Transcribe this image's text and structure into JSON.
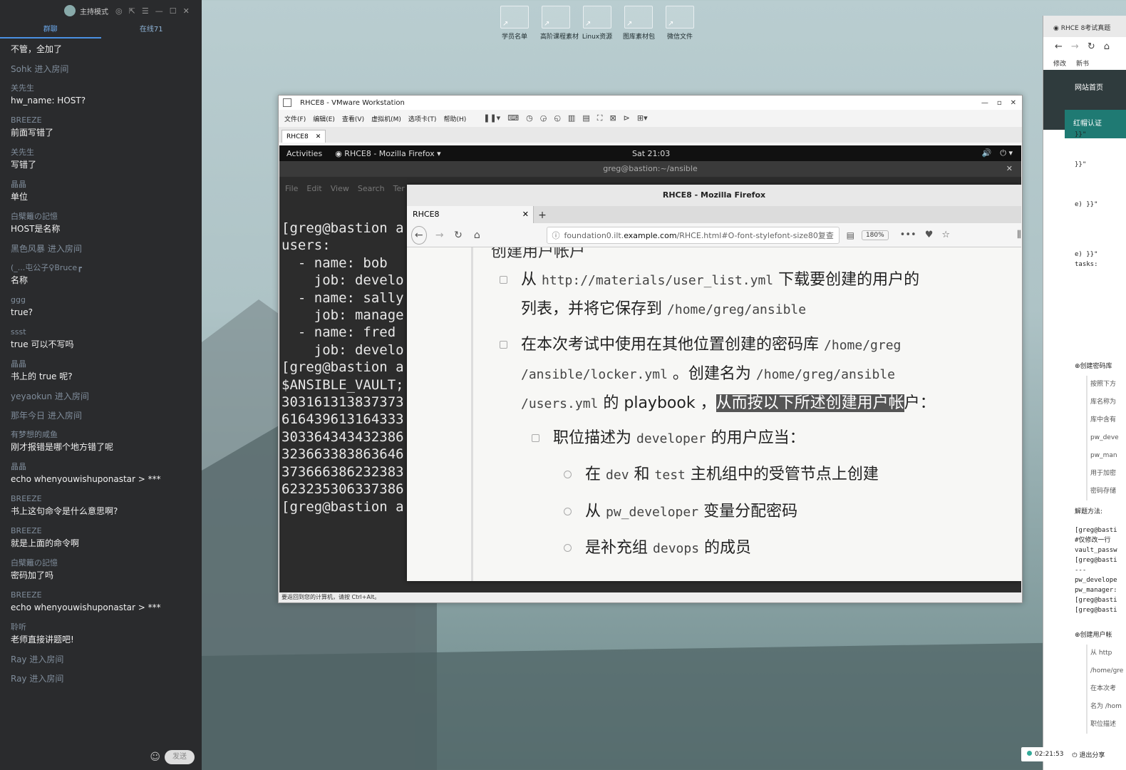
{
  "desktop": {
    "icons": [
      {
        "label": "学员名单"
      },
      {
        "label": "高阶课程素材"
      },
      {
        "label": "Linux资源"
      },
      {
        "label": "图库素材包"
      },
      {
        "label": "微信文件"
      }
    ]
  },
  "chat": {
    "header": {
      "mode": "主持模式"
    },
    "tabs": {
      "group": "群聊",
      "online": "在线71"
    },
    "messages": [
      {
        "name": "",
        "text": "不管，全加了"
      },
      {
        "name": "Sohk 进入房间",
        "text": ""
      },
      {
        "name": "关先生",
        "text": "hw_name: HOST?"
      },
      {
        "name": "BREEZE",
        "text": "前面写错了"
      },
      {
        "name": "关先生",
        "text": "写错了"
      },
      {
        "name": "晶晶",
        "text": "单位"
      },
      {
        "name": "白檗籬の記憶",
        "text": "HOST是名称"
      },
      {
        "name": "黑色风暴 进入房间",
        "text": ""
      },
      {
        "name": "(_...屯公子♀Bruce┏",
        "text": "名称"
      },
      {
        "name": "ggg",
        "text": "true?"
      },
      {
        "name": "ssst",
        "text": "true 可以不写吗"
      },
      {
        "name": "晶晶",
        "text": "书上的 true 呢?"
      },
      {
        "name": "yeyaokun 进入房间",
        "text": ""
      },
      {
        "name": "那年今日 进入房间",
        "text": ""
      },
      {
        "name": "有梦想的咸鱼",
        "text": "刚才报错是哪个地方错了呢"
      },
      {
        "name": "晶晶",
        "text": "echo whenyouwishuponastar > ***"
      },
      {
        "name": "BREEZE",
        "text": "书上这句命令是什么意思啊?"
      },
      {
        "name": "BREEZE",
        "text": "就是上面的命令啊"
      },
      {
        "name": "白檗籬の記憶",
        "text": "密码加了吗"
      },
      {
        "name": "BREEZE",
        "text": "echo whenyouwishuponastar > ***"
      },
      {
        "name": "聆听",
        "text": "老师直接讲题吧!"
      },
      {
        "name": "Ray 进入房间",
        "text": ""
      },
      {
        "name": "Ray 进入房间",
        "text": ""
      }
    ],
    "send_label": "发送"
  },
  "vmware": {
    "title": "RHCE8 - VMware Workstation",
    "menu": [
      "文件(F)",
      "编辑(E)",
      "查看(V)",
      "虚拟机(M)",
      "选项卡(T)",
      "帮助(H)"
    ],
    "tab": "RHCE8",
    "status": "要返回到您的计算机，请按 Ctrl+Alt。"
  },
  "gnome": {
    "activities": "Activities",
    "app": "RHCE8 - Mozilla Firefox",
    "clock": "Sat 21:03"
  },
  "terminal": {
    "title": "greg@bastion:~/ansible",
    "menu": [
      "File",
      "Edit",
      "View",
      "Search",
      "Ter"
    ],
    "lines": [
      "[greg@bastion a",
      "users:",
      "  - name: bob",
      "    job: develo",
      "  - name: sally",
      "    job: manage",
      "  - name: fred",
      "    job: develo",
      "[greg@bastion a",
      "$ANSIBLE_VAULT;",
      "303161313837373",
      "616439613164333",
      "303364343432386",
      "323663383863646",
      "373666386232383",
      "623235306337386",
      "[greg@bastion a"
    ]
  },
  "firefox": {
    "window_title": "RHCE8 - Mozilla Firefox",
    "tab_title": "RHCE8",
    "url_prefix": "foundation0.ilt.",
    "url_domain": "example.com",
    "url_path": "/RHCE.html#O-font-stylefont-size80复查",
    "zoom": "180%",
    "page": {
      "heading": "创建用户帐户",
      "p1_a": "从",
      "p1_url": "http://materials/user_list.yml",
      "p1_b": "下载要创建的用户的",
      "p1_c": "列表，并将它保存到",
      "p1_path": "/home/greg/ansible",
      "p2_a": "在本次考试中使用在其他位置创建的密码库",
      "p2_path1": "/home/greg",
      "p2_path2": "/ansible/locker.yml",
      "p2_b": "。创建名为",
      "p2_path3": "/home/greg/ansible",
      "p2_path4": "/users.yml",
      "p2_c": "的 playbook ，",
      "p2_hl": "从而按以下所述创建用户帐",
      "p2_d": "户：",
      "sub1_a": "职位描述为",
      "sub1_code": "developer",
      "sub1_b": "的用户应当：",
      "s1_a": "在",
      "s1_c1": "dev",
      "s1_b": "和",
      "s1_c2": "test",
      "s1_c": "主机组中的受管节点上创建",
      "s2_a": "从",
      "s2_code": "pw_developer",
      "s2_b": "变量分配密码",
      "s3_a": "是补充组",
      "s3_code": "devops",
      "s3_b": "的成员"
    }
  },
  "rightwin": {
    "tab": "RHCE 8考试真题",
    "bookmarks": [
      "修改",
      "新书"
    ],
    "nav": [
      "网站首页",
      "红帽认证"
    ],
    "code_top": [
      "}}\"",
      "",
      "",
      "}}\"",
      "",
      "",
      "",
      "e) }}\"",
      "",
      "",
      "",
      "",
      "e) }}\"",
      "tasks:"
    ],
    "section1": "⊕创建密码库",
    "list1": [
      "按照下方",
      "库名称为",
      "库中含有",
      "pw_deve",
      "pw_man",
      "用于加密",
      "密码存储"
    ],
    "solution": "解题方法:",
    "code_bottom": [
      "[greg@basti",
      "#仅修改一行",
      "vault_passw",
      "[greg@basti",
      "---",
      "pw_develope",
      "pw_manager:",
      "[greg@basti",
      "[greg@basti"
    ],
    "section2": "⊕创建用户帐",
    "list2": [
      "从 http",
      "/home/gre",
      "在本次考",
      "名为 /hom",
      "职位描述"
    ]
  },
  "bottom_status": {
    "time": "02:21:53",
    "exit": "退出分享"
  }
}
